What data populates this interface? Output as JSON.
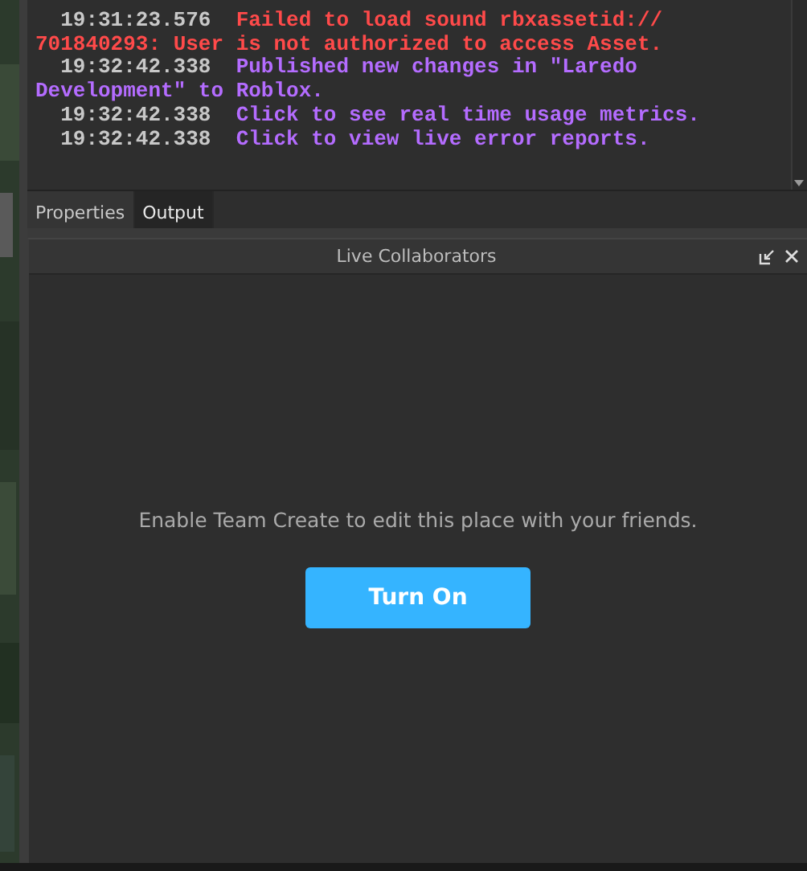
{
  "output": {
    "lines": [
      {
        "timestamp": "19:31:23.576",
        "message": "Failed to load sound rbxassetid://",
        "kind": "error"
      },
      {
        "message": "701840293: User is not authorized to access Asset.",
        "kind": "error"
      },
      {
        "timestamp": "19:32:42.338",
        "message": "Published new changes in \"Laredo",
        "kind": "info"
      },
      {
        "message": "Development\" to Roblox.",
        "kind": "info"
      },
      {
        "timestamp": "19:32:42.338",
        "message": "Click to see real time usage metrics.",
        "kind": "info"
      },
      {
        "timestamp": "19:32:42.338",
        "message": "Click to view live error reports.",
        "kind": "info"
      }
    ]
  },
  "tabs": [
    {
      "label": "Properties",
      "selected": false
    },
    {
      "label": "Output",
      "selected": true
    }
  ],
  "live_collaborators": {
    "title": "Live Collaborators",
    "message": "Enable Team Create to edit this place with your friends.",
    "button": "Turn On"
  }
}
